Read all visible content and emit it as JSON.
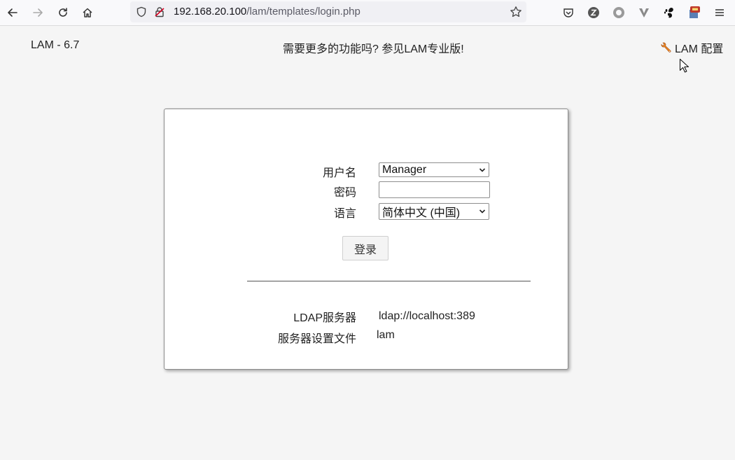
{
  "browser": {
    "url_host": "192.168.20.100",
    "url_path": "/lam/templates/login.php"
  },
  "header": {
    "version": "LAM - 6.7",
    "promo": "需要更多的功能吗? 参见LAM专业版!",
    "config_link": "LAM 配置"
  },
  "login": {
    "username_label": "用户名",
    "username_value": "Manager",
    "password_label": "密码",
    "password_value": "",
    "language_label": "语言",
    "language_value": "简体中文 (中国)",
    "submit_label": "登录"
  },
  "server_info": {
    "ldap_label": "LDAP服务器",
    "ldap_value": "ldap://localhost:389",
    "profile_label": "服务器设置文件",
    "profile_value": "lam"
  },
  "icons": [
    "back-icon",
    "forward-icon",
    "reload-icon",
    "home-icon",
    "shield-icon",
    "lock-icon",
    "star-icon",
    "pocket-icon",
    "zotero-icon",
    "circle-extension-icon",
    "vivaldi-icon",
    "gnome-icon",
    "extension-icon",
    "menu-icon",
    "wrench-icon",
    "mouse-cursor-icon"
  ]
}
